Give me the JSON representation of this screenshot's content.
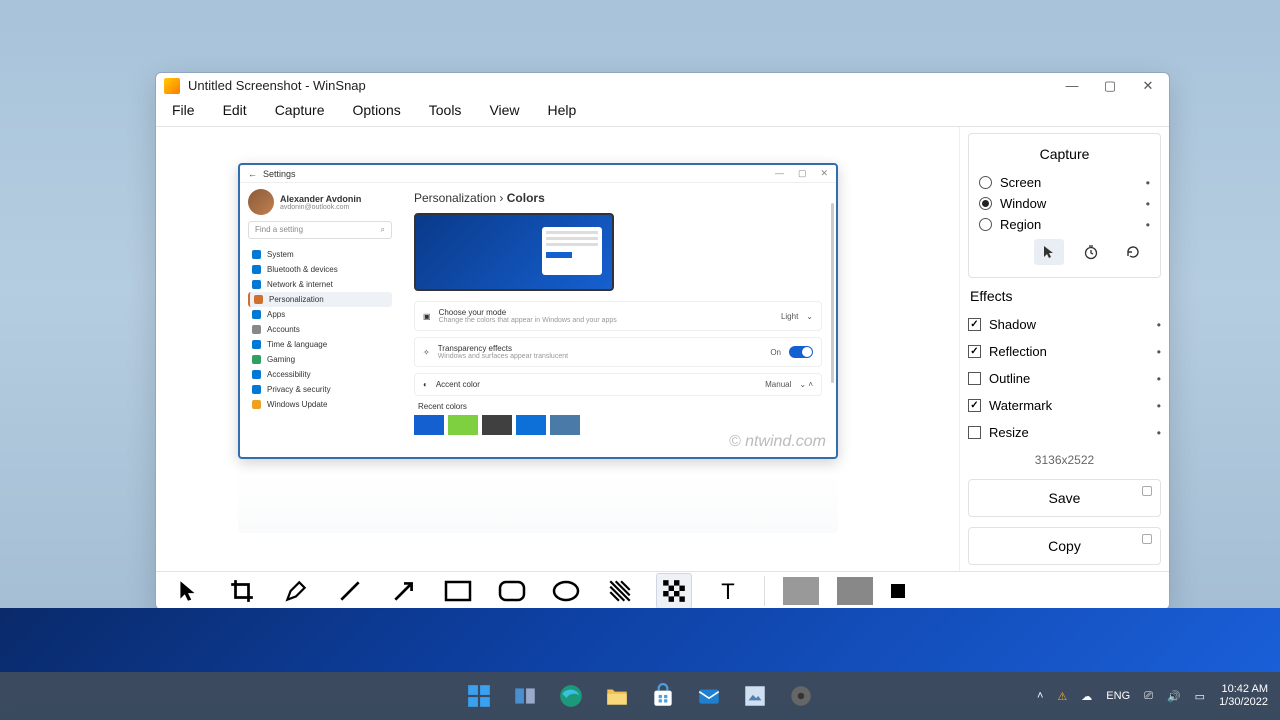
{
  "window": {
    "title": "Untitled Screenshot - WinSnap"
  },
  "menu": [
    "File",
    "Edit",
    "Capture",
    "Options",
    "Tools",
    "View",
    "Help"
  ],
  "capture": {
    "header": "Capture",
    "modes": [
      {
        "label": "Screen",
        "selected": false
      },
      {
        "label": "Window",
        "selected": true
      },
      {
        "label": "Region",
        "selected": false
      }
    ]
  },
  "effects": {
    "header": "Effects",
    "items": [
      {
        "label": "Shadow",
        "checked": true
      },
      {
        "label": "Reflection",
        "checked": true
      },
      {
        "label": "Outline",
        "checked": false
      },
      {
        "label": "Watermark",
        "checked": true
      },
      {
        "label": "Resize",
        "checked": false
      }
    ],
    "dims": "3136x2522"
  },
  "buttons": {
    "save": "Save",
    "copy": "Copy"
  },
  "shot": {
    "app": "Settings",
    "user": {
      "name": "Alexander Avdonin",
      "email": "avdonin@outlook.com"
    },
    "search": "Find a setting",
    "nav": [
      "System",
      "Bluetooth & devices",
      "Network & internet",
      "Personalization",
      "Apps",
      "Accounts",
      "Time & language",
      "Gaming",
      "Accessibility",
      "Privacy & security",
      "Windows Update"
    ],
    "breadcrumb_a": "Personalization",
    "breadcrumb_sep": "›",
    "breadcrumb_b": "Colors",
    "rows": {
      "mode_t": "Choose your mode",
      "mode_s": "Change the colors that appear in Windows and your apps",
      "mode_v": "Light",
      "trans_t": "Transparency effects",
      "trans_s": "Windows and surfaces appear translucent",
      "trans_v": "On",
      "accent_t": "Accent color",
      "accent_v": "Manual",
      "recent": "Recent colors"
    },
    "colors": [
      "#1560d0",
      "#7fd040",
      "#404040",
      "#0d6fd8",
      "#4a7aa8"
    ],
    "watermark": "© ntwind.com"
  },
  "tray": {
    "lang": "ENG",
    "time": "10:42 AM",
    "date": "1/30/2022"
  }
}
